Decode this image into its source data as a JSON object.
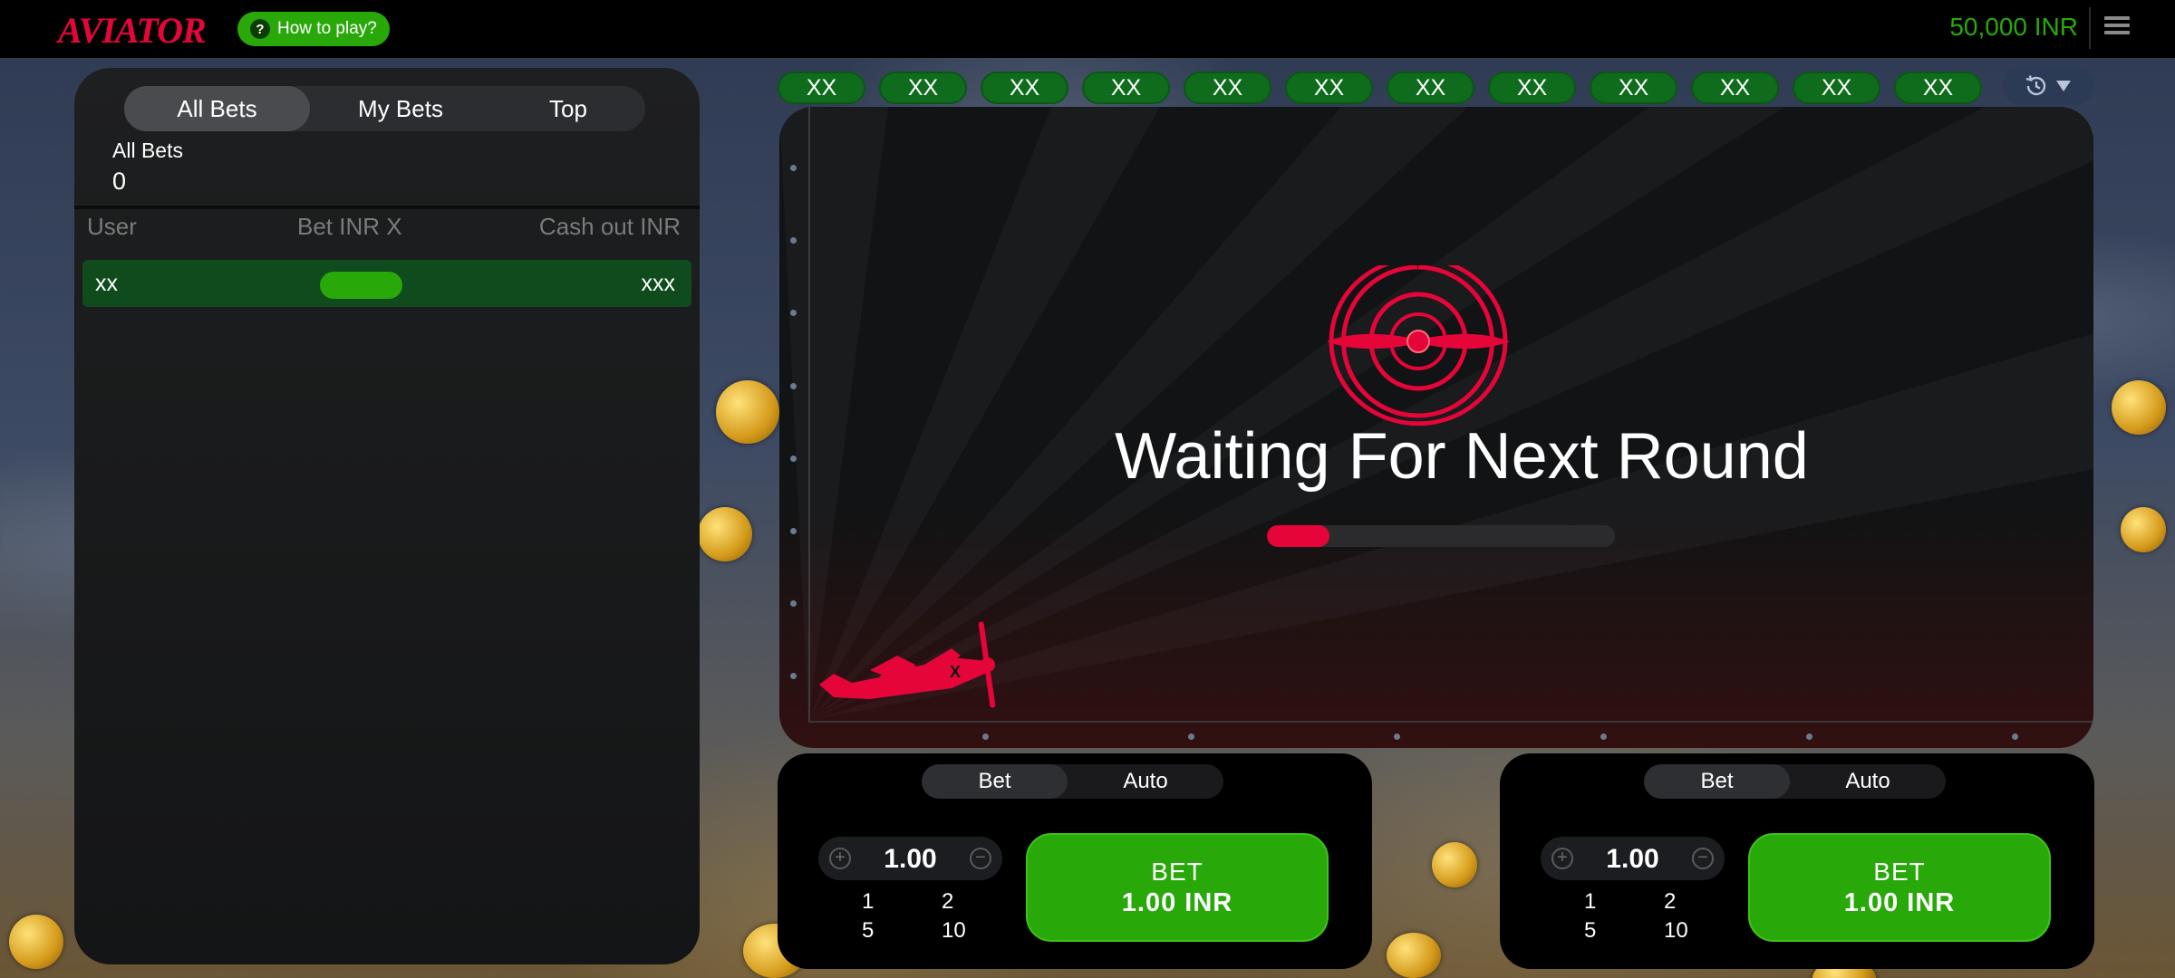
{
  "header": {
    "logo": "AVIATOR",
    "how_to_play": "How to play?",
    "how_to_play_icon": "?",
    "balance": "50,000 INR",
    "menu_icon": "hamburger-menu-icon"
  },
  "bets_panel": {
    "tabs": [
      {
        "label": "All Bets",
        "active": true
      },
      {
        "label": "My Bets",
        "active": false
      },
      {
        "label": "Top",
        "active": false
      }
    ],
    "all_bets_label": "All Bets",
    "all_bets_count": "0",
    "columns": {
      "user": "User",
      "bet": "Bet INR X",
      "cashout": "Cash out INR"
    },
    "rows": [
      {
        "user": "xx",
        "cashout": "xxx"
      }
    ]
  },
  "history": {
    "chips": [
      "XX",
      "XX",
      "XX",
      "XX",
      "XX",
      "XX",
      "XX",
      "XX",
      "XX",
      "XX",
      "XX",
      "XX"
    ],
    "history_icon": "history-clock-icon",
    "dropdown_icon": "chevron-down-icon"
  },
  "game": {
    "status_text": "Waiting For Next Round",
    "progress_fraction": 0.18,
    "accent_color": "#e50539"
  },
  "bet_panels": [
    {
      "tabs": [
        {
          "label": "Bet",
          "active": true
        },
        {
          "label": "Auto",
          "active": false
        }
      ],
      "amount": "1.00",
      "quick_amounts": [
        "1",
        "2",
        "5",
        "10"
      ],
      "bet_label": "BET",
      "bet_amount": "1.00 INR"
    },
    {
      "tabs": [
        {
          "label": "Bet",
          "active": true
        },
        {
          "label": "Auto",
          "active": false
        }
      ],
      "amount": "1.00",
      "quick_amounts": [
        "1",
        "2",
        "5",
        "10"
      ],
      "bet_label": "BET",
      "bet_amount": "1.00 INR"
    }
  ],
  "colors": {
    "brand_red": "#e50539",
    "green": "#28a909",
    "dark_green": "#0f4b1c"
  }
}
